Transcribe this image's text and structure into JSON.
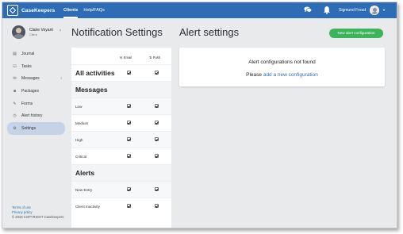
{
  "app": {
    "name": "CaseKeepers"
  },
  "nav": {
    "items": [
      "Clients",
      "Help/FAQs"
    ],
    "active": "Clients"
  },
  "header": {
    "user_name": "Sigmund Freud",
    "chat_icon": "chat-icon",
    "bell_icon": "bell-icon"
  },
  "sidebar": {
    "client_name": "Claire Voyant",
    "client_role": "Client",
    "items": [
      {
        "label": "Journal",
        "icon": "journal-icon"
      },
      {
        "label": "Tasks",
        "icon": "tasks-icon"
      },
      {
        "label": "Messages",
        "icon": "messages-icon",
        "has_chevron": true
      },
      {
        "label": "Packages",
        "icon": "packages-icon"
      },
      {
        "label": "Forms",
        "icon": "forms-icon"
      },
      {
        "label": "Alert history",
        "icon": "history-icon"
      },
      {
        "label": "Settings",
        "icon": "settings-icon",
        "active": true
      }
    ],
    "footer": {
      "terms": "Terms of use",
      "privacy": "Privacy policy",
      "copyright": "© 2019 COPYRIGHT Casekeepers"
    }
  },
  "notifications": {
    "title": "Notification Settings",
    "columns": {
      "email": "Email",
      "push": "Push"
    },
    "rows": [
      {
        "label": "All activities",
        "type": "section",
        "email": true,
        "push": true
      },
      {
        "label": "Messages",
        "type": "header"
      },
      {
        "label": "Low",
        "type": "item",
        "email": true,
        "push": true
      },
      {
        "label": "Medium",
        "type": "item",
        "email": true,
        "push": true
      },
      {
        "label": "High",
        "type": "item",
        "email": true,
        "push": true
      },
      {
        "label": "Critical",
        "type": "item",
        "email": true,
        "push": true
      },
      {
        "label": "Alerts",
        "type": "header"
      },
      {
        "label": "New Entry",
        "type": "item",
        "email": true,
        "push": true
      },
      {
        "label": "Client Inactivity",
        "type": "item",
        "email": true,
        "push": true
      }
    ]
  },
  "alerts": {
    "title": "Alert settings",
    "new_button": "New alert configuration",
    "empty_message": "Alert configurations not found",
    "cta_prefix": "Please",
    "cta_link": "add a new configuration"
  },
  "colors": {
    "brand": "#2e6db6",
    "success": "#3cb55a",
    "active_nav": "#c6d3e6"
  }
}
